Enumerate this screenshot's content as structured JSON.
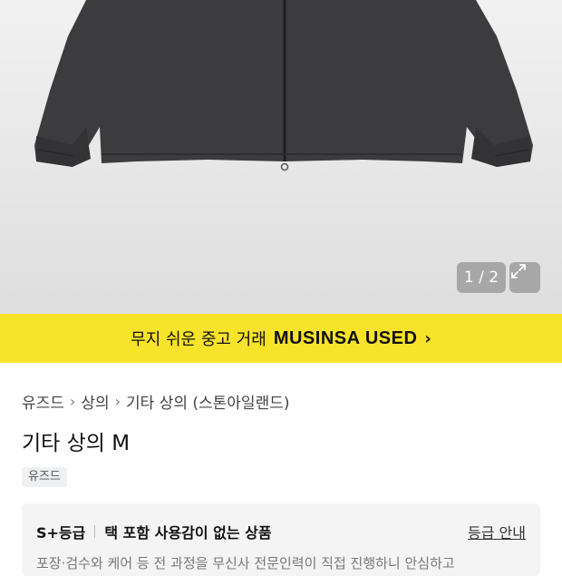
{
  "gallery": {
    "counter": "1 / 2",
    "expand_icon": "expand-arrows-icon"
  },
  "banner": {
    "lead": "무지 쉬운 중고 거래",
    "brand": "MUSINSA USED",
    "chevron": "›"
  },
  "breadcrumb": {
    "items": [
      "유즈드",
      "상의",
      "기타 상의 (스톤아일랜드)"
    ],
    "separator": "›"
  },
  "product": {
    "title": "기타 상의 M",
    "tag": "유즈드"
  },
  "grade": {
    "grade_label": "S+등급",
    "description": "택 포함 사용감이 없는 상품",
    "guide_link": "등급 안내",
    "note": "포장·검수와 케어 등 전 과정을 무신사 전문인력이 직접 진행하니 안심하고"
  },
  "colors": {
    "banner": "#f7e32a",
    "jacket": "#3a3a3c"
  }
}
